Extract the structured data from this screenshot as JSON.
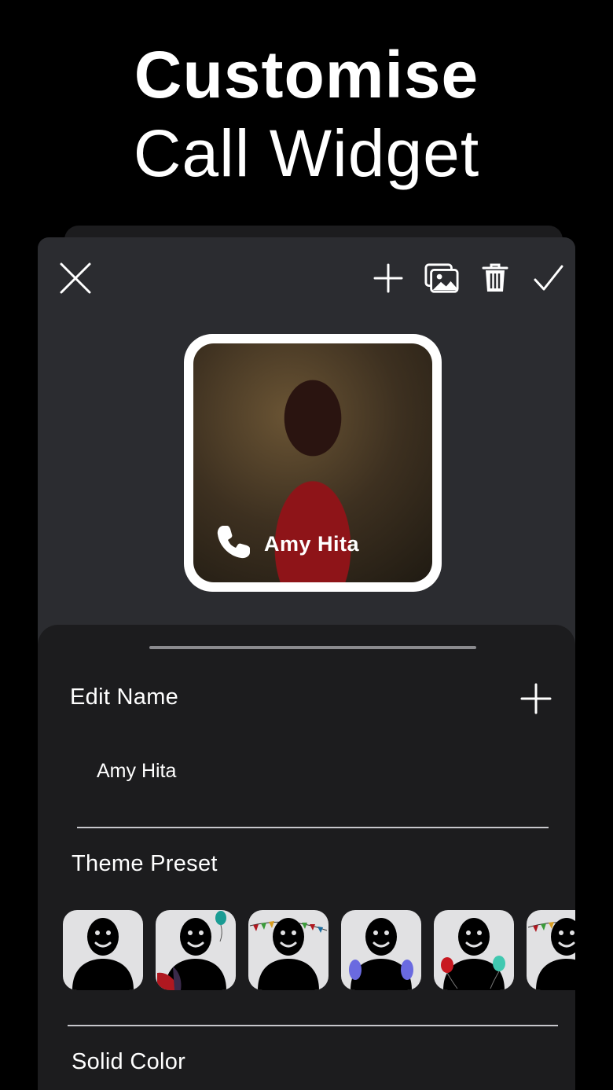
{
  "hero": {
    "line1": "Customise",
    "line2": "Call Widget"
  },
  "toolbar": {
    "close_icon": "close-icon",
    "add_icon": "plus-icon",
    "gallery_icon": "gallery-icon",
    "delete_icon": "trash-icon",
    "confirm_icon": "checkmark-icon"
  },
  "widget": {
    "contact_name": "Amy Hita",
    "icon": "phone-icon"
  },
  "sheet": {
    "edit_name_label": "Edit Name",
    "name_value": "Amy Hita",
    "theme_preset_label": "Theme Preset",
    "solid_color_label": "Solid Color",
    "presets": [
      {
        "name": "plain"
      },
      {
        "name": "balloons-corner"
      },
      {
        "name": "bunting"
      },
      {
        "name": "blue-balloons"
      },
      {
        "name": "red-teal-balloons"
      },
      {
        "name": "bunting-2"
      }
    ]
  },
  "colors": {
    "background": "#000000",
    "panel": "#2b2c30",
    "sheet": "#1c1c1e",
    "tile": "#e1e1e3"
  }
}
